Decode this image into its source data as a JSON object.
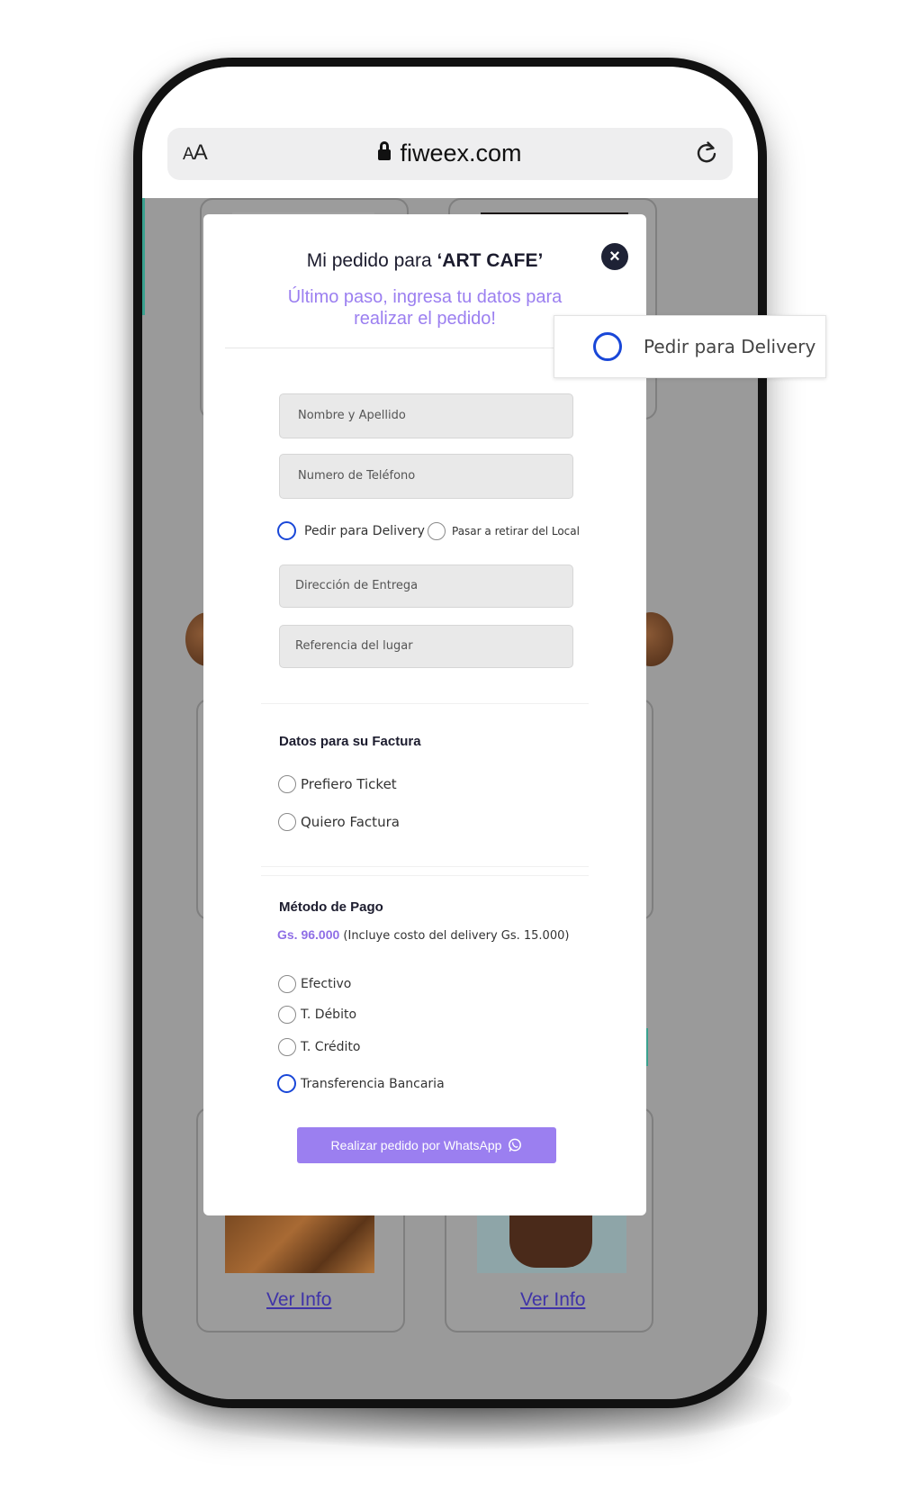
{
  "browser": {
    "text_size_button": "AA",
    "url": "fiweex.com"
  },
  "background": {
    "cards": [
      {
        "link": "Ver Info"
      },
      {
        "link": "Ver Info"
      }
    ]
  },
  "modal": {
    "title_prefix": "Mi pedido para ",
    "title_brand": "‘ART CAFE’",
    "close_label": "×",
    "subtitle": "Último paso, ingresa tu datos para realizar el pedido!",
    "fields": {
      "name_placeholder": "Nombre y Apellido",
      "phone_placeholder": "Numero de Teléfono",
      "address_placeholder": "Dirección de Entrega",
      "reference_placeholder": "Referencia del lugar"
    },
    "delivery_options": [
      {
        "label": "Pedir para Delivery",
        "highlighted": true
      },
      {
        "label": "Pasar a retirar del Local",
        "highlighted": false
      }
    ],
    "invoice": {
      "title": "Datos para su Factura",
      "options": [
        "Prefiero Ticket",
        "Quiero Factura"
      ]
    },
    "payment": {
      "title": "Método de Pago",
      "price": "Gs. 96.000",
      "price_note": " (Incluye costo del delivery Gs. 15.000)",
      "options": [
        {
          "label": "Efectivo",
          "highlighted": false
        },
        {
          "label": "T. Débito",
          "highlighted": false
        },
        {
          "label": "T. Crédito",
          "highlighted": false
        },
        {
          "label": "Transferencia Bancaria",
          "highlighted": true
        }
      ]
    },
    "submit_label": "Realizar pedido por WhatsApp"
  },
  "callout": {
    "label": "Pedir para Delivery"
  },
  "colors": {
    "accent_purple": "#9b7ff0",
    "radio_blue": "#1947d8",
    "close_dark": "#1e2235"
  }
}
